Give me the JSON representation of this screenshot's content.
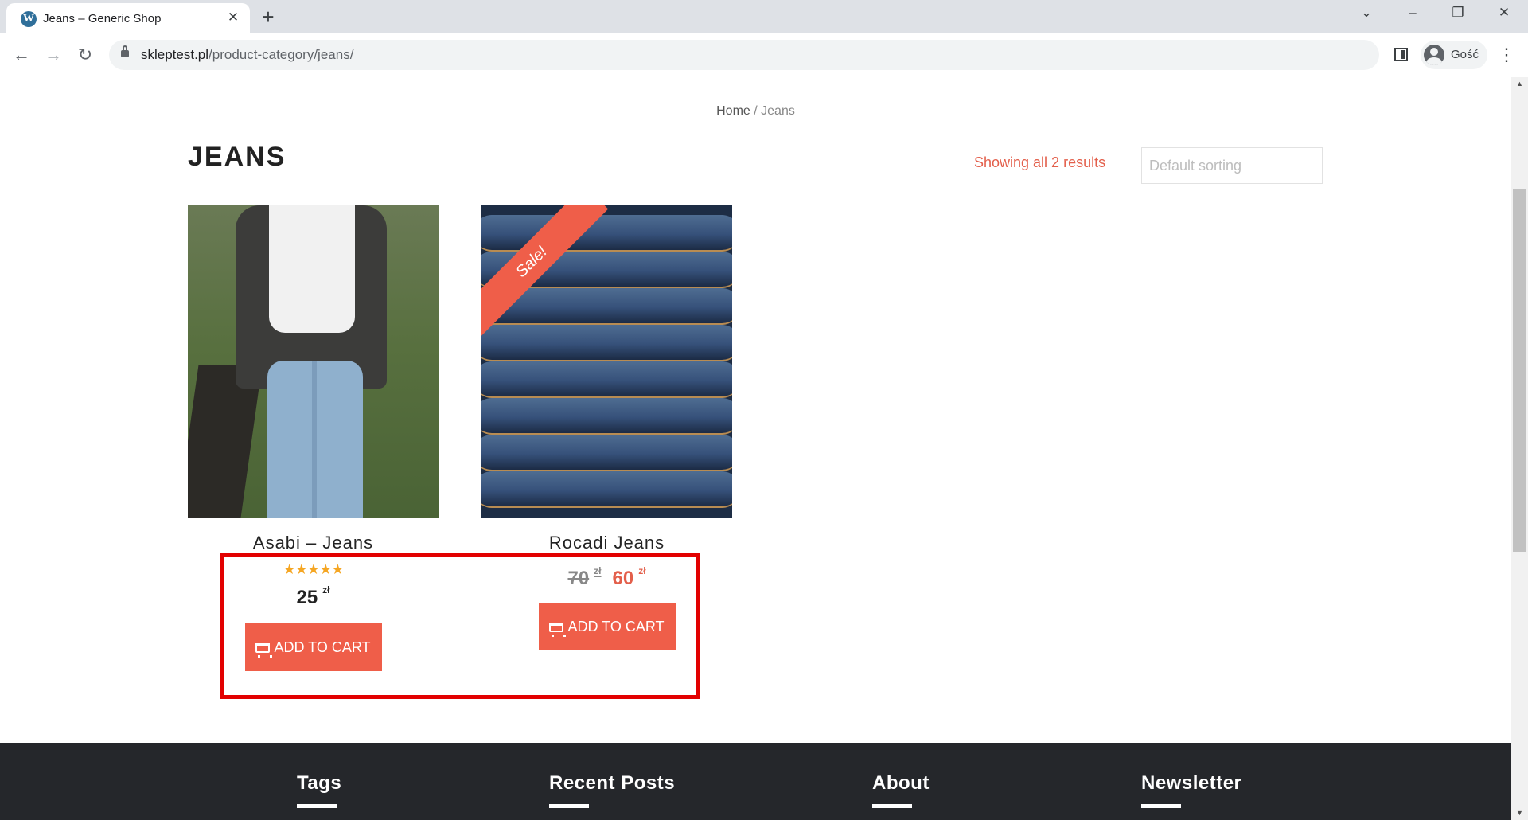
{
  "browser": {
    "tab_title": "Jeans – Generic Shop",
    "favicon": "W",
    "url_host": "skleptest.pl",
    "url_path": "/product-category/jeans/",
    "profile_label": "Gość"
  },
  "page": {
    "breadcrumb": {
      "home": "Home",
      "separator": " / ",
      "current": "Jeans"
    },
    "title": "JEANS",
    "result_count": "Showing all 2 results",
    "sort_placeholder": "Default sorting"
  },
  "products": [
    {
      "name": "Asabi – Jeans",
      "rating_stars": "★★★★★",
      "rating": 5,
      "price": "25",
      "currency": "zł",
      "cart_label": "Add to cart"
    },
    {
      "name": "Rocadi Jeans",
      "sale_badge": "Sale!",
      "old_price": "70",
      "price": "60",
      "currency": "zł",
      "cart_label": "Add to cart"
    }
  ],
  "footer": {
    "columns": [
      "Tags",
      "Recent Posts",
      "About",
      "Newsletter"
    ]
  },
  "colors": {
    "accent": "#ef5e49",
    "highlight_border": "#e20000",
    "footer_bg": "#25272b"
  },
  "icons": [
    "wordpress-icon",
    "close-icon",
    "plus-icon",
    "chevron-down-icon",
    "minimize-icon",
    "restore-icon",
    "back-icon",
    "forward-icon",
    "reload-icon",
    "lock-icon",
    "side-panel-icon",
    "profile-icon",
    "menu-icon",
    "cart-icon",
    "star-icon"
  ]
}
